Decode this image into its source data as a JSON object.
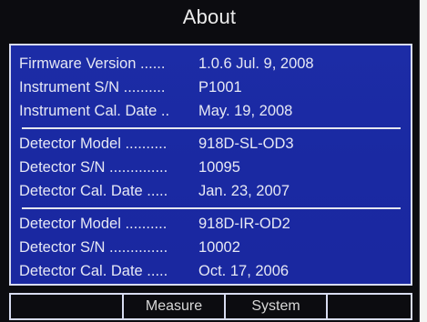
{
  "screen": {
    "title": "About"
  },
  "info": {
    "instrument": [
      {
        "label": "Firmware Version ......",
        "value": "1.0.6  Jul.  9, 2008"
      },
      {
        "label": "Instrument S/N ..........",
        "value": "P1001"
      },
      {
        "label": "Instrument Cal. Date ..",
        "value": "May. 19, 2008"
      }
    ],
    "detector_1": [
      {
        "label": "Detector Model ..........",
        "value": "918D-SL-OD3"
      },
      {
        "label": "Detector S/N ..............",
        "value": "10095"
      },
      {
        "label": "Detector Cal. Date .....",
        "value": "Jan. 23, 2007"
      }
    ],
    "detector_2": [
      {
        "label": "Detector Model ..........",
        "value": "918D-IR-OD2"
      },
      {
        "label": "Detector S/N ..............",
        "value": "10002"
      },
      {
        "label": "Detector Cal. Date .....",
        "value": "Oct. 17, 2006"
      }
    ]
  },
  "softkeys": {
    "key1": "",
    "key2": "Measure",
    "key3": "System",
    "key4": ""
  },
  "colors": {
    "panel_background": "#1c2ca6",
    "screen_background": "#0c0c10",
    "text": "#e6e8f4",
    "border": "#d8dcf0"
  }
}
